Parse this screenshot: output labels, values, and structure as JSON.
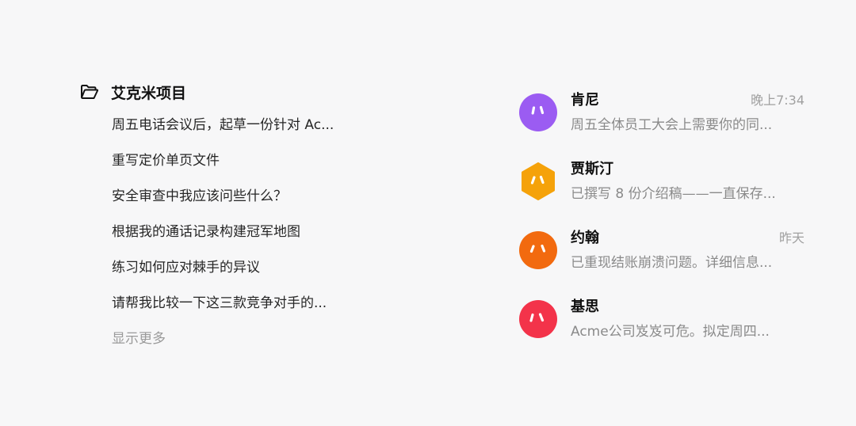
{
  "project": {
    "title": "艾克米项目",
    "icon": "folder-open-icon",
    "threads": [
      "周五电话会议后，起草一份针对 Ac...",
      "重写定价单页文件",
      "安全审查中我应该问些什么？",
      "根据我的通话记录构建冠军地图",
      "练习如何应对棘手的异议",
      "请帮我比较一下这三款竞争对手的..."
    ],
    "show_more": "显示更多"
  },
  "chats": [
    {
      "name": "肯尼",
      "time": "晚上7:34",
      "preview": "周五全体员工大会上需要你的同...",
      "avatar_shape": "circle",
      "color": "#9b5cf2"
    },
    {
      "name": "贾斯汀",
      "time": "",
      "preview": "已撰写 8 份介绍稿——一直保存...",
      "avatar_shape": "hexagon",
      "color": "#f5a20a"
    },
    {
      "name": "约翰",
      "time": "昨天",
      "preview": "已重现结账崩溃问题。详细信息...",
      "avatar_shape": "circle",
      "color": "#f26a0f"
    },
    {
      "name": "基思",
      "time": "",
      "preview": "Acme公司岌岌可危。拟定周四...",
      "avatar_shape": "circle",
      "color": "#f3334a"
    }
  ]
}
